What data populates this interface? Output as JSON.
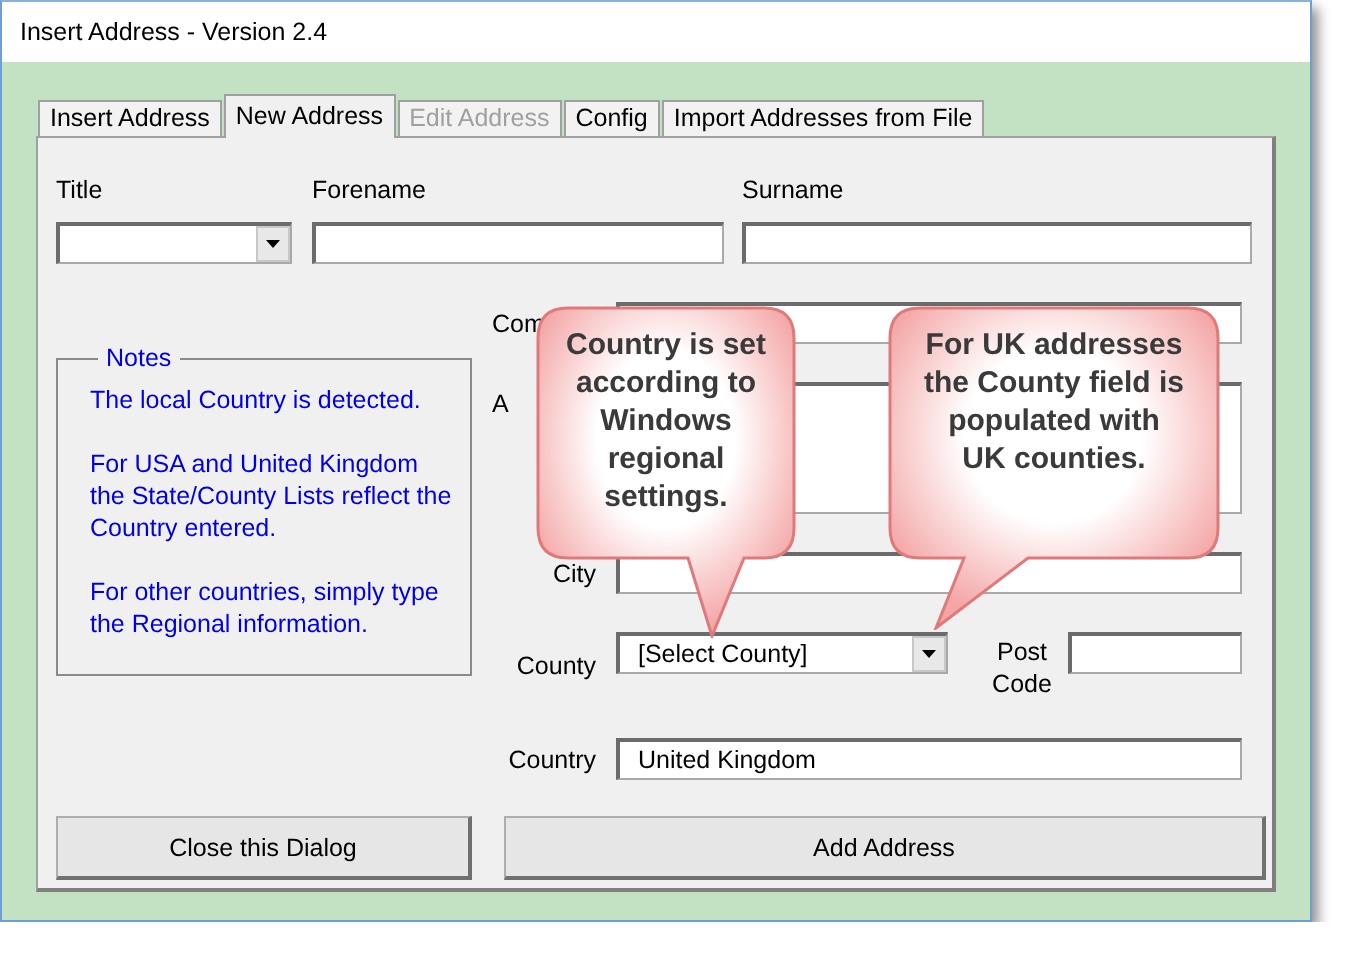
{
  "window": {
    "title": "Insert Address - Version 2.4"
  },
  "tabs": [
    {
      "label": "Insert Address",
      "selected": false,
      "disabled": false
    },
    {
      "label": "New Address",
      "selected": true,
      "disabled": false
    },
    {
      "label": "Edit Address",
      "selected": false,
      "disabled": true
    },
    {
      "label": "Config",
      "selected": false,
      "disabled": false
    },
    {
      "label": "Import Addresses from File",
      "selected": false,
      "disabled": false
    }
  ],
  "name_fields": [
    {
      "label": "Title",
      "kind": "combo"
    },
    {
      "label": "Forename",
      "kind": "text"
    },
    {
      "label": "Surname",
      "kind": "text"
    }
  ],
  "notes": {
    "title": "Notes",
    "paragraphs": [
      "The local Country is detected.",
      "For USA and United Kingdom the State/County Lists reflect the Country entered.",
      "For other countries, simply type the Regional information."
    ]
  },
  "address_fields": [
    {
      "label": "Com",
      "kind": "text"
    },
    {
      "label": "A",
      "kind": "area"
    },
    {
      "label": "City",
      "kind": "text"
    },
    {
      "label": "County",
      "kind": "combo",
      "value": "[Select County]",
      "extra": {
        "label": "Post Code"
      }
    },
    {
      "label": "Country",
      "kind": "text",
      "value": "United Kingdom"
    }
  ],
  "buttons": [
    "Close this Dialog",
    "Add Address"
  ],
  "callouts": [
    {
      "text": "Country is set according to Windows regional settings.",
      "kind": "down"
    },
    {
      "text": "For UK addresses the County field is populated with UK counties.",
      "kind": "left"
    }
  ]
}
